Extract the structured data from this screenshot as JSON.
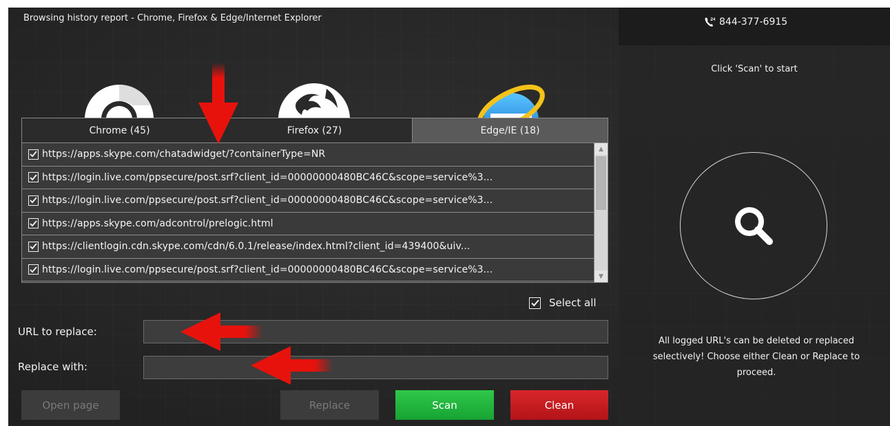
{
  "window": {
    "title": "Browsing history report - Chrome, Firefox & Edge/Internet Explorer"
  },
  "right_panel": {
    "phone": "844-377-6915",
    "phone_icon": "phone-24h-icon",
    "hint_top": "Click 'Scan' to start",
    "scan_icon": "search-icon",
    "hint_bottom": "All logged URL's can be deleted or replaced selectively! Choose either Clean or Replace to proceed."
  },
  "browsers": {
    "logos": [
      "chrome-logo-icon",
      "firefox-logo-icon",
      "internet-explorer-logo-icon"
    ],
    "tabs": [
      {
        "label": "Chrome (45)",
        "active": false
      },
      {
        "label": "Firefox (27)",
        "active": false
      },
      {
        "label": "Edge/IE (18)",
        "active": true
      }
    ]
  },
  "url_list": {
    "items": [
      {
        "url": "https://apps.skype.com/chatadwidget/?containerType=NR",
        "checked": true
      },
      {
        "url": "https://login.live.com/ppsecure/post.srf?client_id=00000000480BC46C&scope=service%3...",
        "checked": true
      },
      {
        "url": "https://login.live.com/ppsecure/post.srf?client_id=00000000480BC46C&scope=service%3...",
        "checked": true
      },
      {
        "url": "https://apps.skype.com/adcontrol/prelogic.html",
        "checked": true
      },
      {
        "url": "https://clientlogin.cdn.skype.com/cdn/6.0.1/release/index.html?client_id=439400&uiv...",
        "checked": true
      },
      {
        "url": "https://login.live.com/ppsecure/post.srf?client_id=00000000480BC46C&scope=service%3...",
        "checked": true
      }
    ],
    "select_all_label": "Select all",
    "select_all_checked": true
  },
  "form": {
    "url_to_replace_label": "URL to replace:",
    "url_to_replace_value": "",
    "replace_with_label": "Replace with:",
    "replace_with_value": ""
  },
  "buttons": {
    "open_page": "Open page",
    "replace": "Replace",
    "scan": "Scan",
    "clean": "Clean"
  },
  "colors": {
    "scan_green": "#1fb63d",
    "clean_red": "#c41c20",
    "annotation_arrow_red": "#e8120c"
  }
}
